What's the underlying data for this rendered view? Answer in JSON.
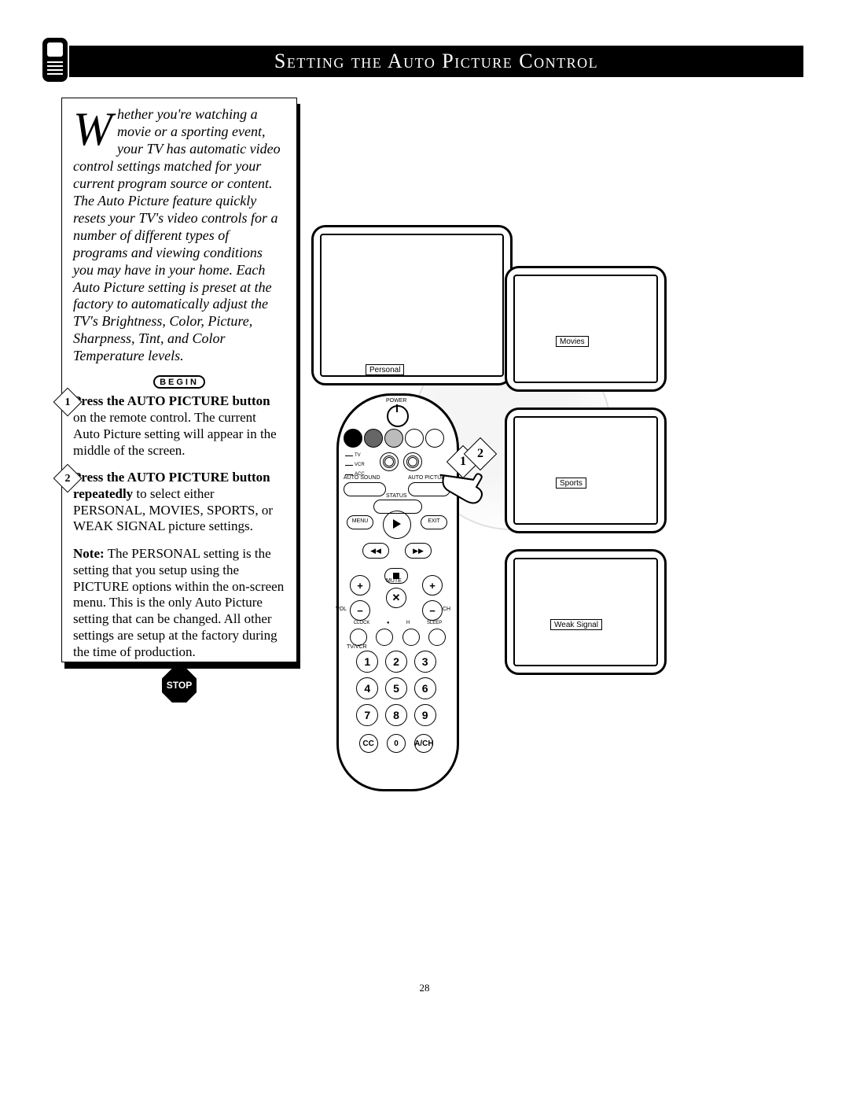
{
  "title": "Setting the Auto Picture Control",
  "pageNumber": "28",
  "intro": {
    "dropcap": "W",
    "text": "hether you're watching a movie or a sporting event, your TV has automatic video control settings matched for your current program source or content. The Auto Picture feature quickly resets your TV's video controls for a number of different types of programs and viewing conditions you may have in your home. Each Auto Picture setting is preset at the factory to automatically adjust the TV's Brightness, Color, Picture, Sharpness, Tint, and Color Temperature levels."
  },
  "labels": {
    "begin": "BEGIN",
    "stop": "STOP",
    "noteHead": "Note:"
  },
  "steps": [
    {
      "n": "1",
      "bold": "Press the AUTO PICTURE button",
      "rest": " on the remote control. The current Auto Picture setting will appear in the middle of the screen."
    },
    {
      "n": "2",
      "bold": "Press the AUTO PICTURE button repeatedly",
      "rest": " to select either PERSONAL, MOVIES, SPORTS, or WEAK SIGNAL picture settings."
    }
  ],
  "note": " The PERSONAL setting is the setting that you setup using the PICTURE options within the on-screen menu. This is the only Auto Picture setting that can be changed. All other settings are setup at the factory during the time of production.",
  "tv": {
    "main": "Personal",
    "movies": "Movies",
    "sports": "Sports",
    "weak": "Weak Signal"
  },
  "remote": {
    "power": "POWER",
    "modes": [
      "TV",
      "VCR",
      "ACC"
    ],
    "autosound": "AUTO SOUND",
    "autopic": "AUTO PICTURE",
    "status": "STATUS",
    "menu": "MENU",
    "exit": "EXIT",
    "mute": "MUTE",
    "vol": "VOL",
    "ch": "CH",
    "row4": [
      "CLOCK",
      "●",
      "H",
      "SLEEP"
    ],
    "tvvcr": "TV/VCR",
    "keypad": [
      "1",
      "2",
      "3",
      "4",
      "5",
      "6",
      "7",
      "8",
      "9"
    ],
    "bottom": [
      "CC",
      "0",
      "A/CH"
    ]
  },
  "callout": [
    "1",
    "2"
  ]
}
